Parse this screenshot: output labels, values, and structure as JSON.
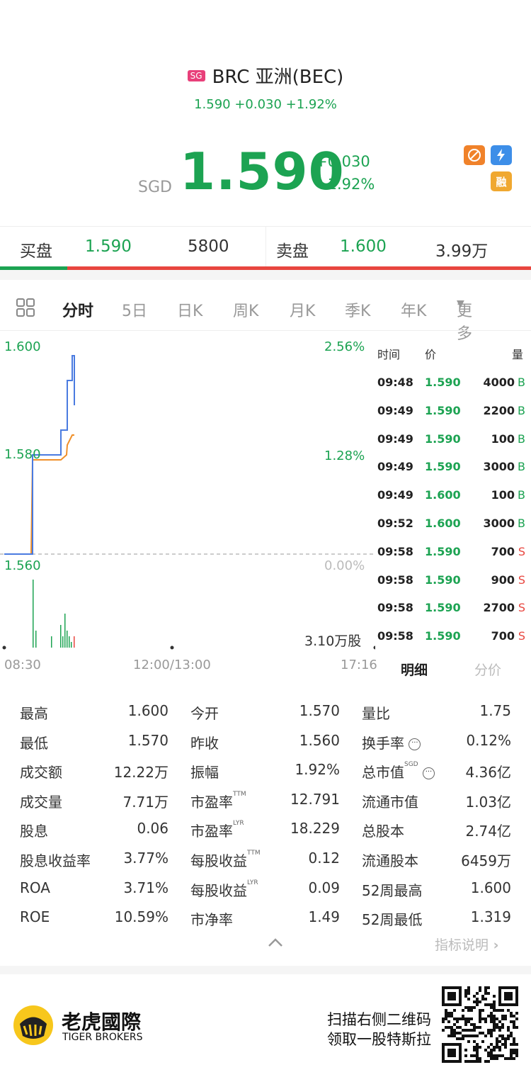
{
  "header": {
    "market_badge": "SG",
    "title": "BRC 亚洲(BEC)",
    "subtitle": "1.590 +0.030 +1.92%"
  },
  "quote": {
    "currency": "SGD",
    "price": "1.590",
    "change": "+0.030",
    "change_pct": "+1.92%",
    "icons": [
      "no-short-icon",
      "lightning-icon",
      "margin-icon"
    ],
    "margin_label": "融"
  },
  "order_book": {
    "bid_label": "买盘",
    "bid_price": "1.590",
    "bid_size": "5800",
    "ask_label": "卖盘",
    "ask_price": "1.600",
    "ask_size": "3.99万",
    "bid_ratio": 0.127
  },
  "tabs": [
    "分时",
    "5日",
    "日K",
    "周K",
    "月K",
    "季K",
    "年K",
    "更多"
  ],
  "active_tab": "分时",
  "chart": {
    "y_labels_left": [
      "1.600",
      "1.580",
      "1.560"
    ],
    "y_labels_right": [
      "2.56%",
      "1.28%",
      "0.00%"
    ],
    "x_labels": [
      "08:30",
      "12:00/13:00",
      "17:16"
    ],
    "volume_label": "3.10万股"
  },
  "chart_data": {
    "type": "line",
    "title": "",
    "x": [
      "08:30",
      "09:30",
      "09:40",
      "09:45",
      "09:47",
      "09:48",
      "09:49",
      "09:52",
      "09:55",
      "09:58"
    ],
    "series": [
      {
        "values": [
          1.56,
          1.56,
          1.58,
          1.58,
          1.585,
          1.585,
          1.595,
          1.6,
          1.6,
          1.59
        ]
      },
      {
        "values": [
          1.56,
          1.56,
          1.579,
          1.579,
          1.579,
          1.58,
          1.582,
          1.584,
          1.584,
          1.584
        ]
      }
    ],
    "ylim": [
      1.56,
      1.6
    ],
    "volume": [
      0,
      0,
      12,
      3,
      2,
      4,
      2,
      6,
      3,
      2,
      1,
      2
    ]
  },
  "trades": {
    "headers": [
      "时间",
      "价",
      "量"
    ],
    "rows": [
      {
        "time": "09:48",
        "price": "1.590",
        "vol": "4000",
        "side": "B"
      },
      {
        "time": "09:49",
        "price": "1.590",
        "vol": "2200",
        "side": "B"
      },
      {
        "time": "09:49",
        "price": "1.590",
        "vol": "100",
        "side": "B"
      },
      {
        "time": "09:49",
        "price": "1.590",
        "vol": "3000",
        "side": "B"
      },
      {
        "time": "09:49",
        "price": "1.600",
        "vol": "100",
        "side": "B"
      },
      {
        "time": "09:52",
        "price": "1.600",
        "vol": "3000",
        "side": "B"
      },
      {
        "time": "09:58",
        "price": "1.590",
        "vol": "700",
        "side": "S"
      },
      {
        "time": "09:58",
        "price": "1.590",
        "vol": "900",
        "side": "S"
      },
      {
        "time": "09:58",
        "price": "1.590",
        "vol": "2700",
        "side": "S"
      },
      {
        "time": "09:58",
        "price": "1.590",
        "vol": "700",
        "side": "S"
      }
    ],
    "tab_detail": "明细",
    "tab_price": "分价"
  },
  "stats": {
    "col1": [
      {
        "label": "最高",
        "value": "1.600"
      },
      {
        "label": "最低",
        "value": "1.570"
      },
      {
        "label": "成交额",
        "value": "12.22万"
      },
      {
        "label": "成交量",
        "value": "7.71万"
      },
      {
        "label": "股息",
        "value": "0.06"
      },
      {
        "label": "股息收益率",
        "value": "3.77%"
      },
      {
        "label": "ROA",
        "value": "3.71%"
      },
      {
        "label": "ROE",
        "value": "10.59%"
      }
    ],
    "col2": [
      {
        "label": "今开",
        "sup": "",
        "value": "1.570"
      },
      {
        "label": "昨收",
        "sup": "",
        "value": "1.560"
      },
      {
        "label": "振幅",
        "sup": "",
        "value": "1.92%"
      },
      {
        "label": "市盈率",
        "sup": "TTM",
        "value": "12.791"
      },
      {
        "label": "市盈率",
        "sup": "LYR",
        "value": "18.229"
      },
      {
        "label": "每股收益",
        "sup": "TTM",
        "value": "0.12"
      },
      {
        "label": "每股收益",
        "sup": "LYR",
        "value": "0.09"
      },
      {
        "label": "市净率",
        "sup": "",
        "value": "1.49"
      }
    ],
    "col3": [
      {
        "label": "量比",
        "sup": "",
        "value": "1.75"
      },
      {
        "label": "换手率",
        "sup": "",
        "value": "0.12%"
      },
      {
        "label": "总市值",
        "sup": "SGD",
        "value": "4.36亿"
      },
      {
        "label": "流通市值",
        "sup": "",
        "value": "1.03亿"
      },
      {
        "label": "总股本",
        "sup": "",
        "value": "2.74亿"
      },
      {
        "label": "流通股本",
        "sup": "",
        "value": "6459万"
      },
      {
        "label": "52周最高",
        "sup": "",
        "value": "1.600"
      },
      {
        "label": "52周最低",
        "sup": "",
        "value": "1.319"
      }
    ],
    "help_link": "指标说明"
  },
  "footer": {
    "brand_cn": "老虎國際",
    "brand_en": "TIGER BROKERS",
    "promo_line1": "扫描右侧二维码",
    "promo_line2": "领取一股特斯拉"
  },
  "colors": {
    "up": "#1ca352",
    "down": "#e8463f",
    "price_line": "#4a7be0",
    "avg_line": "#f0902a"
  }
}
